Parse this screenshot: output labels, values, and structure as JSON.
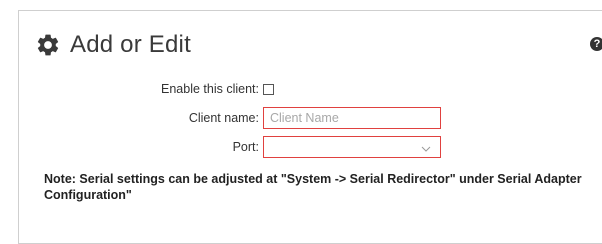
{
  "panel": {
    "title": "Add or Edit",
    "help_label": "?"
  },
  "form": {
    "enable_label": "Enable this client:",
    "enable_checked": false,
    "client_name_label": "Client name:",
    "client_name_value": "",
    "client_name_placeholder": "Client Name",
    "port_label": "Port:",
    "port_value": ""
  },
  "note": "Note: Serial settings can be adjusted at \"System -> Serial Redirector\" under Serial Adapter Configuration\"",
  "colors": {
    "error_border": "#e0413f",
    "icon": "#3a3a3a"
  },
  "icons": {
    "header": "gear-icon",
    "help": "help-icon",
    "select": "chevron-down-icon"
  }
}
